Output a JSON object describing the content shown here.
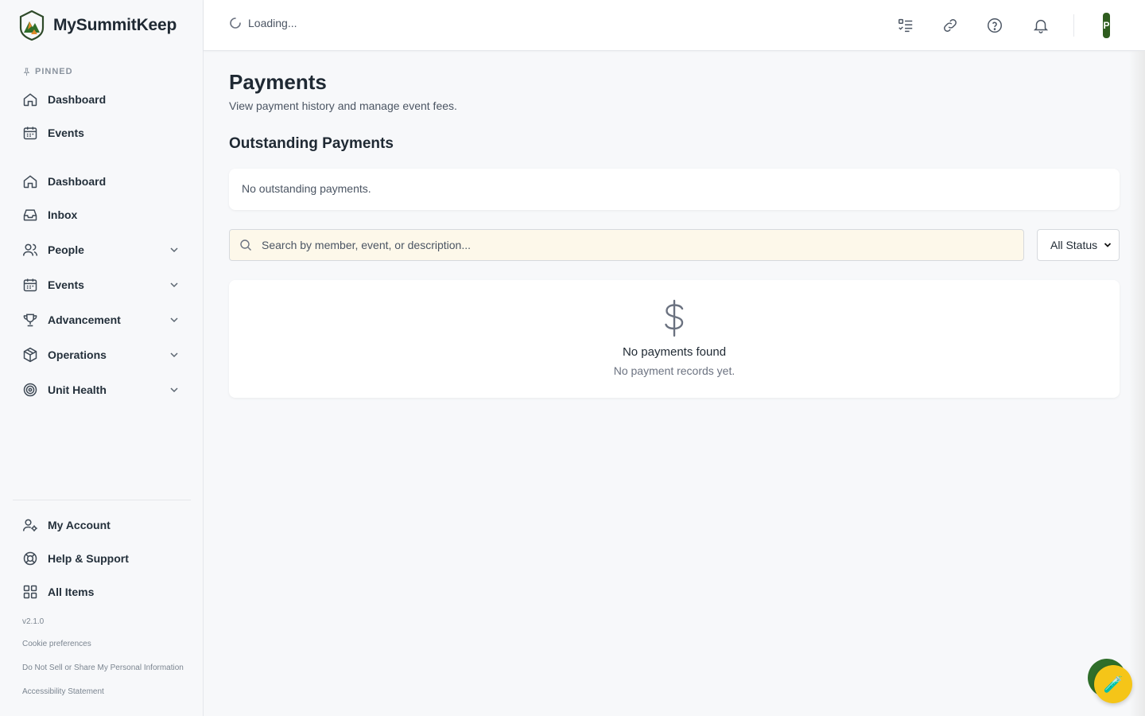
{
  "brand": {
    "name": "MySummitKeep"
  },
  "sidebar": {
    "pinned_label": "PINNED",
    "pinned_items": [
      {
        "label": "Dashboard",
        "icon": "home-icon"
      },
      {
        "label": "Events",
        "icon": "calendar-icon"
      }
    ],
    "items": [
      {
        "label": "Dashboard",
        "icon": "home-icon",
        "expandable": false
      },
      {
        "label": "Inbox",
        "icon": "inbox-icon",
        "expandable": false
      },
      {
        "label": "People",
        "icon": "users-icon",
        "expandable": true
      },
      {
        "label": "Events",
        "icon": "calendar-icon",
        "expandable": true
      },
      {
        "label": "Advancement",
        "icon": "trophy-icon",
        "expandable": true
      },
      {
        "label": "Operations",
        "icon": "box-icon",
        "expandable": true
      },
      {
        "label": "Unit Health",
        "icon": "target-icon",
        "expandable": true
      }
    ],
    "bottom_items": [
      {
        "label": "My Account",
        "icon": "user-settings-icon"
      },
      {
        "label": "Help & Support",
        "icon": "lifebuoy-icon"
      },
      {
        "label": "All Items",
        "icon": "grid-icon"
      }
    ],
    "version": "v2.1.0",
    "footer_links": [
      "Cookie preferences",
      "Do Not Sell or Share My Personal Information",
      "Accessibility Statement"
    ]
  },
  "topbar": {
    "loading_text": "Loading...",
    "icons": [
      "checklist-icon",
      "link-icon",
      "help-icon",
      "bell-icon"
    ],
    "avatar_initial": "P"
  },
  "main": {
    "title": "Payments",
    "subtitle": "View payment history and manage event fees.",
    "outstanding": {
      "title": "Outstanding Payments",
      "empty_text": "No outstanding payments."
    },
    "search": {
      "placeholder": "Search by member, event, or description..."
    },
    "status_filter": {
      "selected": "All Status"
    },
    "empty_state": {
      "title": "No payments found",
      "subtitle": "No payment records yet."
    }
  },
  "colors": {
    "brand_green": "#2f6e2a",
    "fab_yellow": "#f5c518",
    "search_bg": "#fdf8ea"
  }
}
